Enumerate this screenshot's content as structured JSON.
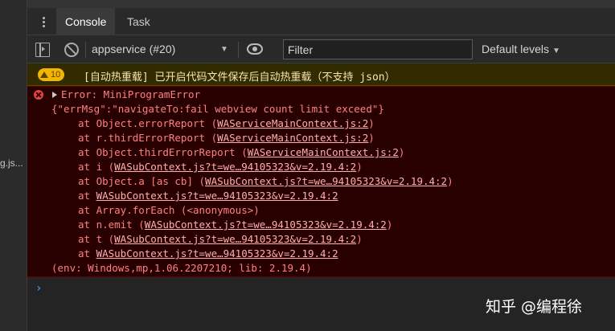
{
  "left_panel": {
    "fragment_text": "g.js..."
  },
  "tabs": [
    {
      "label": "Console",
      "active": true
    },
    {
      "label": "Task",
      "active": false
    }
  ],
  "toolbar": {
    "context": "appservice (#20)",
    "filter_placeholder": "Filter",
    "levels": "Default levels"
  },
  "warning": {
    "count": "10",
    "text": "[自动热重载] 已开启代码文件保存后自动热重载（不支持 json）"
  },
  "error": {
    "title": "Error: MiniProgramError",
    "message": "{\"errMsg\":\"navigateTo:fail webview count limit exceed\"}",
    "frames": [
      {
        "prefix": "at Object.errorReport (",
        "link": "WAServiceMainContext.js:2",
        "suffix": ")"
      },
      {
        "prefix": "at r.thirdErrorReport (",
        "link": "WAServiceMainContext.js:2",
        "suffix": ")"
      },
      {
        "prefix": "at Object.thirdErrorReport (",
        "link": "WAServiceMainContext.js:2",
        "suffix": ")"
      },
      {
        "prefix": "at i (",
        "link": "WASubContext.js?t=we…94105323&v=2.19.4:2",
        "suffix": ")"
      },
      {
        "prefix": "at Object.a [as cb] (",
        "link": "WASubContext.js?t=we…94105323&v=2.19.4:2",
        "suffix": ")"
      },
      {
        "prefix": "at ",
        "link": "WASubContext.js?t=we…94105323&v=2.19.4:2",
        "suffix": ""
      },
      {
        "prefix": "at Array.forEach (<anonymous>)",
        "link": "",
        "suffix": ""
      },
      {
        "prefix": "at n.emit (",
        "link": "WASubContext.js?t=we…94105323&v=2.19.4:2",
        "suffix": ")"
      },
      {
        "prefix": "at t (",
        "link": "WASubContext.js?t=we…94105323&v=2.19.4:2",
        "suffix": ")"
      },
      {
        "prefix": "at ",
        "link": "WASubContext.js?t=we…94105323&v=2.19.4:2",
        "suffix": ""
      }
    ],
    "env": "(env: Windows,mp,1.06.2207210; lib: 2.19.4)"
  },
  "prompt_symbol": "›",
  "watermark": "知乎 @编程徐",
  "colors": {
    "error_bg": "#290000",
    "error_text": "#ff8080",
    "warning_bg": "#332b00",
    "warning_badge": "#f2b600",
    "prompt": "#4aa3ff"
  }
}
